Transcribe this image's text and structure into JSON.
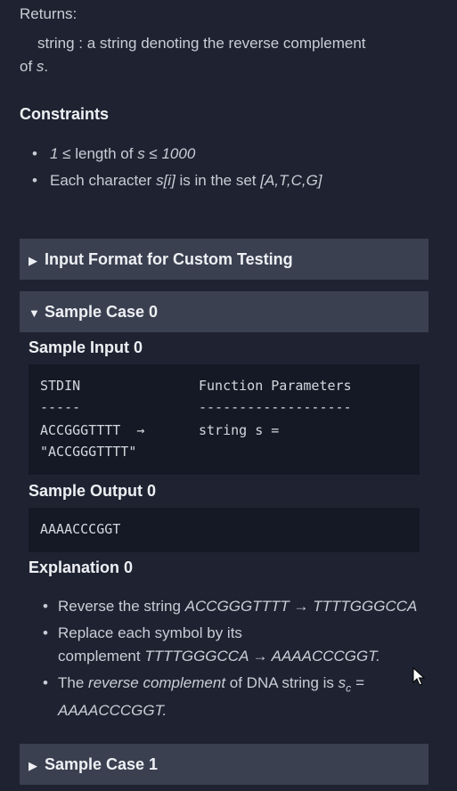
{
  "returns": {
    "label": "Returns:",
    "type": "string",
    "sep": " : ",
    "desc": "a string denoting the reverse complement",
    "of": "of ",
    "var": "s",
    "period": "."
  },
  "constraints": {
    "title": "Constraints",
    "c1": {
      "math1": "1 ≤",
      "text": " length of ",
      "math2": "s ≤ 1000"
    },
    "c2": {
      "text1": "Each character ",
      "math1": "s[i]",
      "text2": " is in the set ",
      "math2": "[A,T,C,G]"
    }
  },
  "input_format": {
    "label": "Input Format for Custom Testing",
    "icon": "triangle-right-icon"
  },
  "sample0": {
    "header": "Sample Case 0",
    "icon": "triangle-down-icon",
    "input_title": "Sample Input 0",
    "stdin_label": "STDIN",
    "func_label": "Function Parameters",
    "dash1": "-----",
    "dash2": "-------------------",
    "line_val": "ACCGGGTTTT",
    "arrow": "→",
    "param": "string s =",
    "param_val": "\"ACCGGGTTTT\"",
    "output_title": "Sample Output 0",
    "output": "AAAACCCGGT",
    "expl_title": "Explanation 0",
    "b1": {
      "t1": "Reverse the string ",
      "m1": "ACCGGGTTTT → TTTTGGGCCA"
    },
    "b2": {
      "t1": "Replace each symbol by its",
      "t2": "complement ",
      "m1": "TTTTGGGCCA → AAAACCCGGT."
    },
    "b3": {
      "t1": "The ",
      "m1": "reverse complement",
      "t2": " of DNA string is ",
      "m2": "s",
      "sub": "c",
      "m3": " =",
      "m4": "AAAACCCGGT."
    }
  },
  "sample1": {
    "header": "Sample Case 1",
    "icon": "triangle-right-icon"
  }
}
